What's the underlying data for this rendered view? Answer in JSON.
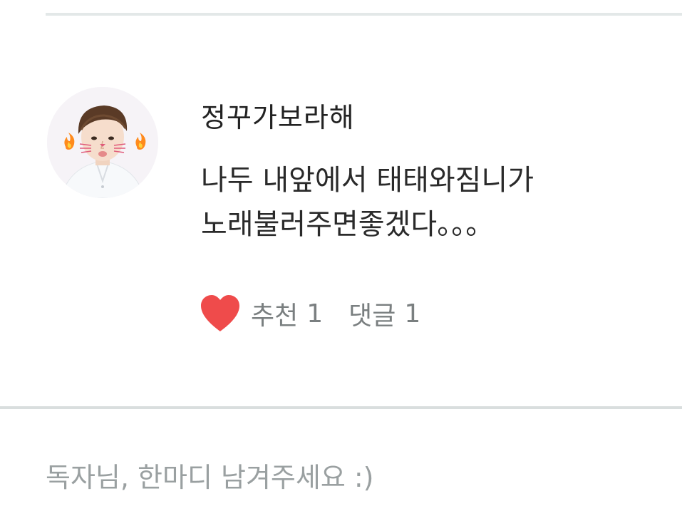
{
  "comment": {
    "author": "정꾸가보라해",
    "text_lines": [
      "나두 내앞에서 태태와짐니가",
      "노래불러주면좋겠다。。。"
    ],
    "recommend_label": "추천",
    "recommend_count": "1",
    "reply_label": "댓글",
    "reply_count": "1",
    "heart_color": "#ef4b4b"
  },
  "reply_box": {
    "placeholder": "독자님, 한마디 남겨주세요 :)"
  },
  "icons": {
    "heart": "heart-icon",
    "avatar": "user-avatar"
  }
}
